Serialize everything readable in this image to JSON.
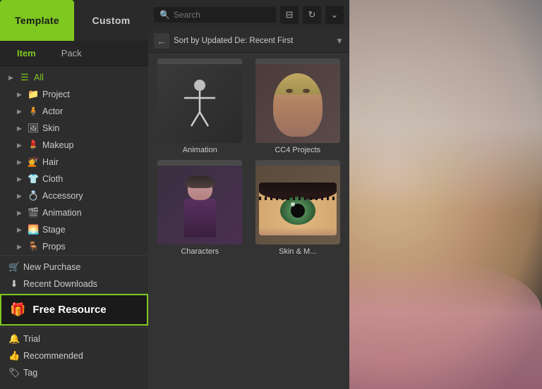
{
  "tabs": {
    "template": "Template",
    "custom": "Custom"
  },
  "item_pack": {
    "item_label": "Item",
    "pack_label": "Pack"
  },
  "search": {
    "placeholder": "Search"
  },
  "sort": {
    "label": "Sort by Updated De: Recent First"
  },
  "tree": {
    "all": "All",
    "items": [
      {
        "id": "project",
        "label": "Project",
        "icon": "📁"
      },
      {
        "id": "actor",
        "label": "Actor",
        "icon": "🧍"
      },
      {
        "id": "skin",
        "label": "Skin",
        "icon": "🖼"
      },
      {
        "id": "makeup",
        "label": "Makeup",
        "icon": "💄"
      },
      {
        "id": "hair",
        "label": "Hair",
        "icon": "💇"
      },
      {
        "id": "cloth",
        "label": "Cloth",
        "icon": "👕"
      },
      {
        "id": "accessory",
        "label": "Accessory",
        "icon": "💍"
      },
      {
        "id": "animation",
        "label": "Animation",
        "icon": "🎬"
      },
      {
        "id": "stage",
        "label": "Stage",
        "icon": "🌅"
      },
      {
        "id": "props",
        "label": "Props",
        "icon": "🪑"
      }
    ],
    "special": [
      {
        "id": "new-purchase",
        "label": "New Purchase",
        "icon": "🛒"
      },
      {
        "id": "recent-downloads",
        "label": "Recent Downloads",
        "icon": "⬇"
      }
    ],
    "free_resource": "Free Resource",
    "bottom": [
      {
        "id": "trial",
        "label": "Trial",
        "icon": "🔔"
      },
      {
        "id": "recommended",
        "label": "Recommended",
        "icon": "👍"
      },
      {
        "id": "tag",
        "label": "Tag",
        "icon": "🏷"
      }
    ]
  },
  "grid": {
    "items": [
      {
        "id": "animation",
        "label": "Animation"
      },
      {
        "id": "cc4-projects",
        "label": "CC4 Projects"
      },
      {
        "id": "characters",
        "label": "Characters"
      },
      {
        "id": "skin-m",
        "label": "Skin & M..."
      }
    ]
  },
  "toolbar": {
    "filter_icon": "⊟",
    "refresh_icon": "↻",
    "more_icon": "⌄"
  }
}
